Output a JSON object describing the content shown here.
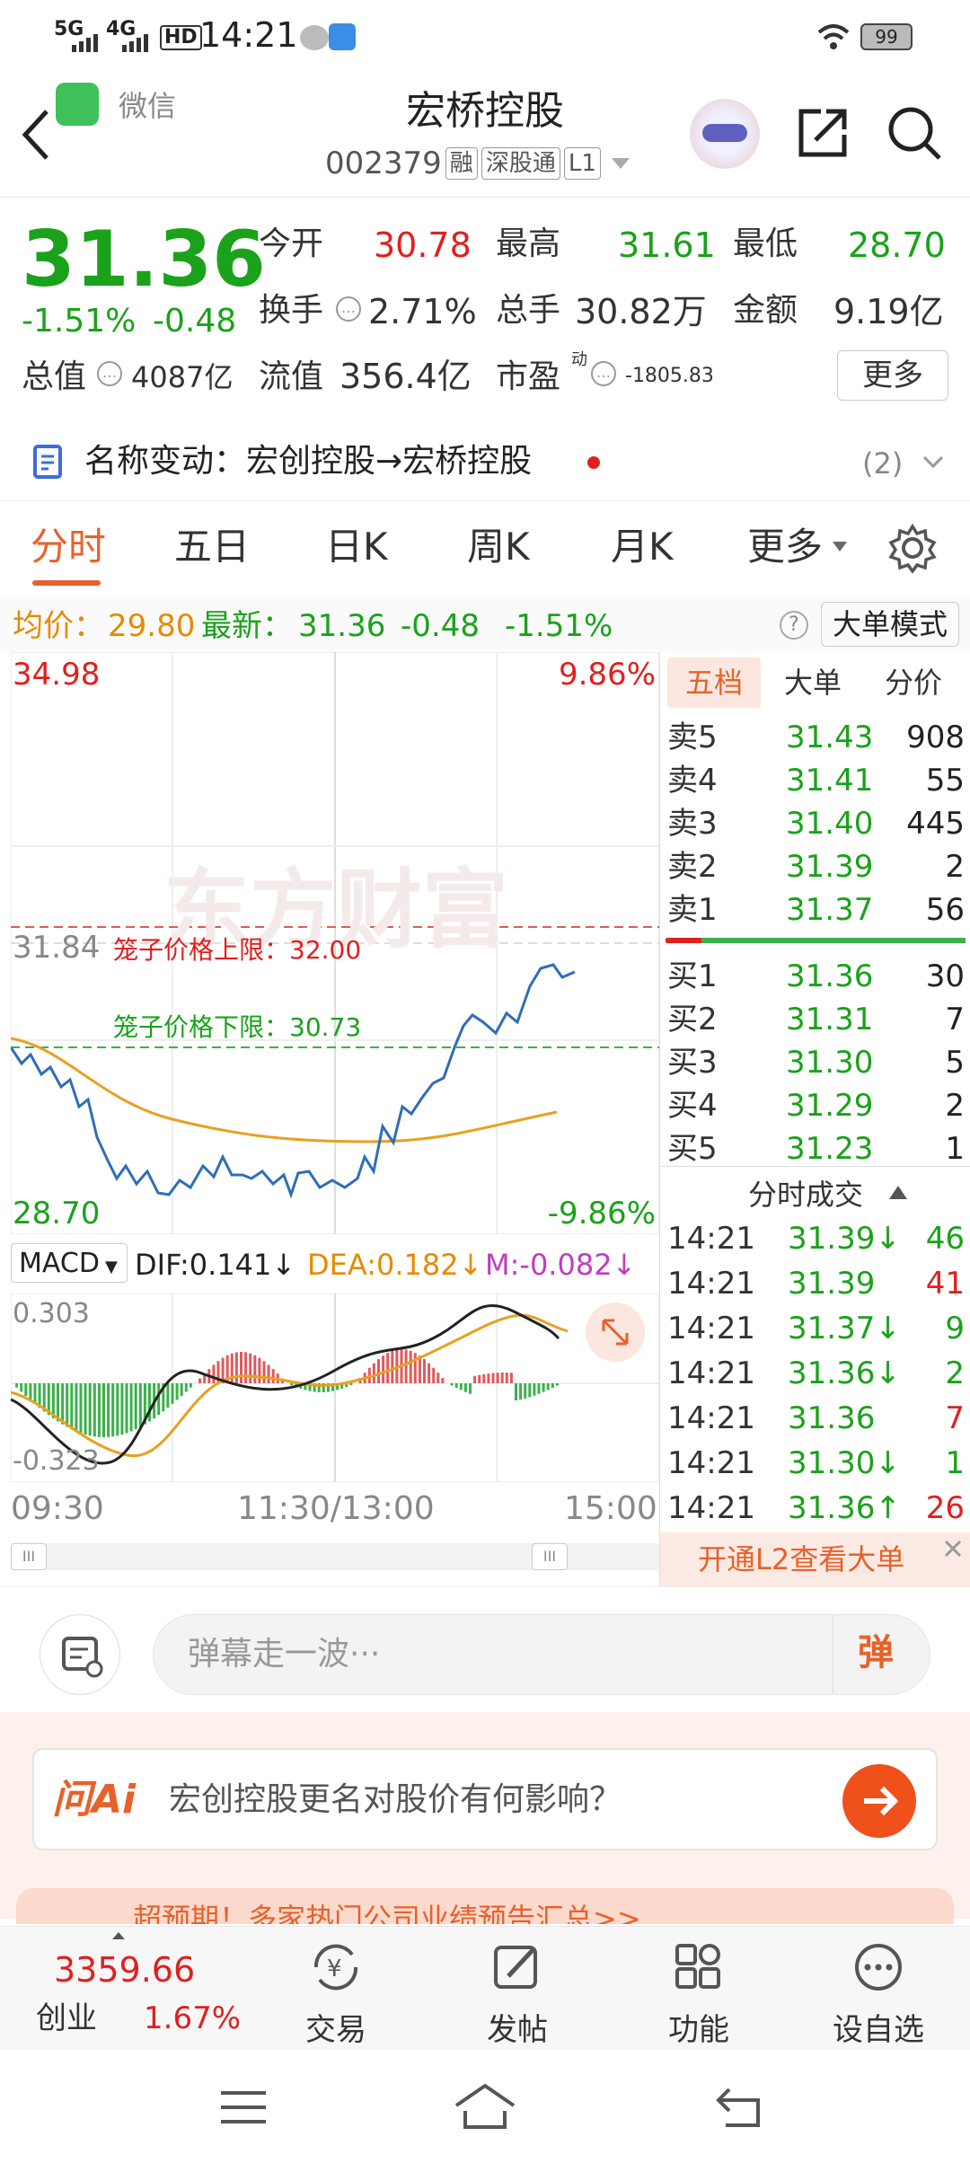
{
  "status": {
    "time": "14:21",
    "net1": "5G",
    "net2": "4G",
    "hd": "HD",
    "battery": "99"
  },
  "header": {
    "back_app": "微信",
    "title": "宏桥控股",
    "code": "002379",
    "tags": [
      "融",
      "深股通",
      "L1"
    ]
  },
  "quote": {
    "price": "31.36",
    "pct": "-1.51%",
    "chg": "-0.48",
    "open_label": "今开",
    "open": "30.78",
    "high_label": "最高",
    "high": "31.61",
    "low_label": "最低",
    "low": "28.70",
    "turnover_label": "换手",
    "turnover": "2.71%",
    "volume_label": "总手",
    "volume": "30.82万",
    "amount_label": "金额",
    "amount": "9.19亿",
    "mcap_label": "总值",
    "mcap": "4087亿",
    "float_label": "流值",
    "float": "356.4亿",
    "pe_label": "市盈",
    "pe_sup": "动",
    "pe": "-1805.83",
    "more": "更多"
  },
  "notice": {
    "text": "名称变动：宏创控股→宏桥控股",
    "count": "(2)"
  },
  "tabs": [
    "分时",
    "五日",
    "日K",
    "周K",
    "月K",
    "更多"
  ],
  "info": {
    "avg_label": "均价：",
    "avg": "29.80",
    "latest_label": "最新：",
    "latest": "31.36",
    "chg": "-0.48",
    "pct": "-1.51%",
    "mode": "大单模式"
  },
  "chart": {
    "y_top": "34.98",
    "y_top_pct": "9.86%",
    "y_mid": "31.84",
    "y_bottom": "28.70",
    "y_bottom_pct": "-9.86%",
    "upper_limit": "笼子价格上限：32.00",
    "lower_limit": "笼子价格下限：30.73",
    "watermark": "东方财富",
    "times": [
      "09:30",
      "11:30/13:00",
      "15:00"
    ]
  },
  "chart_data": {
    "type": "line",
    "ylim": [
      28.7,
      34.98
    ],
    "avg_price": 29.8,
    "latest": 31.36,
    "upper_limit": 32.0,
    "lower_limit": 30.73
  },
  "macd": {
    "name": "MACD",
    "dif": "DIF:0.141",
    "dea": "DEA:0.182",
    "m": "M:-0.082",
    "top": "0.303",
    "bottom": "-0.323"
  },
  "book": {
    "tabs": [
      "五档",
      "大单",
      "分价"
    ],
    "asks": [
      [
        "卖5",
        "31.43",
        "908"
      ],
      [
        "卖4",
        "31.41",
        "55"
      ],
      [
        "卖3",
        "31.40",
        "445"
      ],
      [
        "卖2",
        "31.39",
        "2"
      ],
      [
        "卖1",
        "31.37",
        "56"
      ]
    ],
    "bids": [
      [
        "买1",
        "31.36",
        "30"
      ],
      [
        "买2",
        "31.31",
        "7"
      ],
      [
        "买3",
        "31.30",
        "5"
      ],
      [
        "买4",
        "31.29",
        "2"
      ],
      [
        "买5",
        "31.23",
        "1"
      ]
    ],
    "trades_title": "分时成交",
    "trades": [
      [
        "14:21",
        "31.39↓",
        "46"
      ],
      [
        "14:21",
        "31.39",
        "41"
      ],
      [
        "14:21",
        "31.37↓",
        "9"
      ],
      [
        "14:21",
        "31.36↓",
        "2"
      ],
      [
        "14:21",
        "31.36",
        "7"
      ],
      [
        "14:21",
        "31.30↓",
        "1"
      ],
      [
        "14:21",
        "31.36↑",
        "26"
      ]
    ],
    "l2": "开通L2查看大单"
  },
  "comment": {
    "placeholder": "弹幕走一波···",
    "btn": "弹"
  },
  "ai": {
    "logo": "问Ai",
    "question": "宏创控股更名对股价有何影响？"
  },
  "banner": {
    "text": "超预期！多家热门公司业绩预告汇总>>"
  },
  "nav": {
    "index_val": "3359.66",
    "index_name": "创业",
    "index_pct": "1.67%",
    "items": [
      "交易",
      "发帖",
      "功能",
      "设自选"
    ]
  }
}
